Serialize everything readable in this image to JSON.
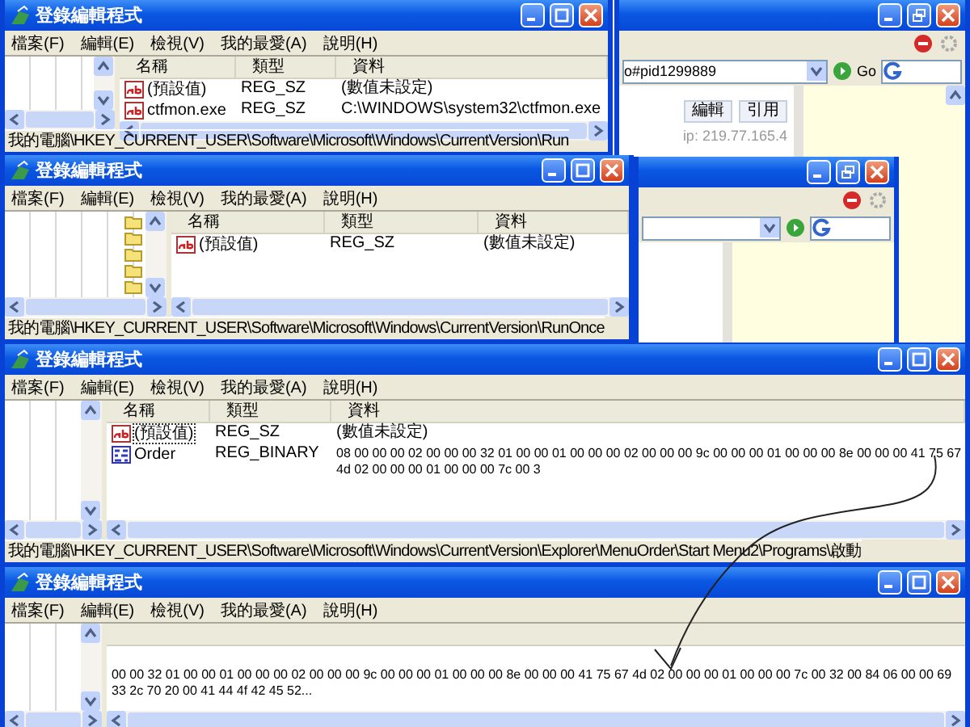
{
  "browser": {
    "address": "o#pid1299889",
    "go_label": "Go",
    "post_buttons": [
      "編輯",
      "引用"
    ],
    "ip_text": "ip: 219.77.165.4"
  },
  "windows": [
    {
      "title": "登錄編輯程式",
      "menu": [
        "檔案(F)",
        "編輯(E)",
        "檢視(V)",
        "我的最愛(A)",
        "說明(H)"
      ],
      "tree_folders": false,
      "columns": [
        "名稱",
        "類型",
        "資料"
      ],
      "rows": [
        {
          "kind": "string",
          "name": "(預設值)",
          "type": "REG_SZ",
          "data": "(數值未設定)",
          "selected": false
        },
        {
          "kind": "string",
          "name": "ctfmon.exe",
          "type": "REG_SZ",
          "data": "C:\\WINDOWS\\system32\\ctfmon.exe",
          "selected": false
        }
      ],
      "status": "我的電腦\\HKEY_CURRENT_USER\\Software\\Microsoft\\Windows\\CurrentVersion\\Run"
    },
    {
      "title": "登錄編輯程式",
      "menu": [
        "檔案(F)",
        "編輯(E)",
        "檢視(V)",
        "我的最愛(A)",
        "說明(H)"
      ],
      "tree_folders": true,
      "columns": [
        "名稱",
        "類型",
        "資料"
      ],
      "rows": [
        {
          "kind": "string",
          "name": "(預設值)",
          "type": "REG_SZ",
          "data": "(數值未設定)",
          "selected": false
        }
      ],
      "status": "我的電腦\\HKEY_CURRENT_USER\\Software\\Microsoft\\Windows\\CurrentVersion\\RunOnce"
    },
    {
      "title": "登錄編輯程式",
      "menu": [
        "檔案(F)",
        "編輯(E)",
        "檢視(V)",
        "我的最愛(A)",
        "說明(H)"
      ],
      "tree_folders": false,
      "columns": [
        "名稱",
        "類型",
        "資料"
      ],
      "rows": [
        {
          "kind": "string",
          "name": "(預設值)",
          "type": "REG_SZ",
          "data": "(數值未設定)",
          "selected": true
        },
        {
          "kind": "binary",
          "name": "Order",
          "type": "REG_BINARY",
          "data": "08 00 00 00 02 00 00 00 32 01 00 00 01 00 00 00 02 00 00 00 9c 00 00 00 01 00 00 00 8e 00 00 00 41 75 67 4d 02 00 00 00 01 00 00 00 7c 00 3",
          "selected": false
        }
      ],
      "status": "我的電腦\\HKEY_CURRENT_USER\\Software\\Microsoft\\Windows\\CurrentVersion\\Explorer\\MenuOrder\\Start Menu2\\Programs\\啟動"
    },
    {
      "title": "登錄編輯程式",
      "menu": [
        "檔案(F)",
        "編輯(E)",
        "檢視(V)",
        "我的最愛(A)",
        "說明(H)"
      ],
      "tree_folders": false,
      "rows": [
        {
          "kind": "data_only",
          "data": "00 00 32 01 00 00 01 00 00 00 02 00 00 00 9c 00 00 00 01 00 00 00 8e 00 00 00 41 75 67 4d 02 00 00 00 01 00 00 00 7c 00 32 00 84 06 00 00 69 33 2c 70 20 00 41 44 4f 42 45 52...",
          "selected": false
        }
      ]
    }
  ]
}
